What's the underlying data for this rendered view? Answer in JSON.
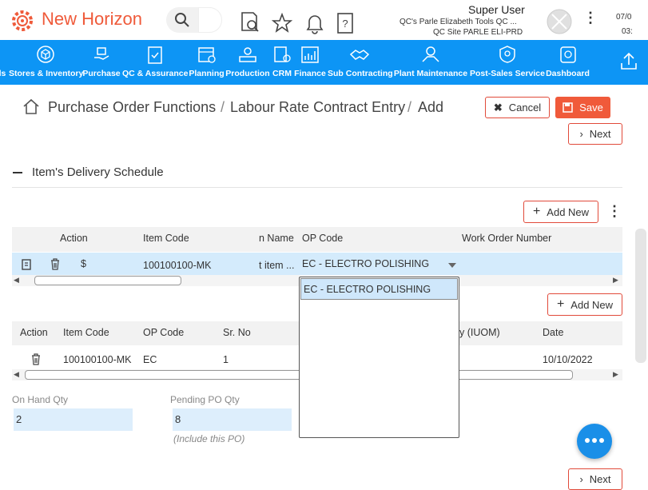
{
  "header": {
    "app_name": "New Horizon",
    "user_name": "Super User",
    "user_org": "QC's Parle Elizabeth Tools QC ...",
    "user_site": "QC Site PARLE ELI-PRD",
    "date_part1": "07/0",
    "date_part2": "03:",
    "kebab": "⋮"
  },
  "nav": {
    "items": [
      {
        "label": "ls"
      },
      {
        "label": "Stores & Inventory"
      },
      {
        "label": "Purchase"
      },
      {
        "label": "QC & Assurance"
      },
      {
        "label": "Planning"
      },
      {
        "label": "Production"
      },
      {
        "label": "CRM"
      },
      {
        "label": "Finance"
      },
      {
        "label": "Sub Contracting"
      },
      {
        "label": "Plant Maintenance"
      },
      {
        "label": "Post-Sales Service"
      },
      {
        "label": "Dashboard"
      }
    ]
  },
  "breadcrumb": {
    "part1": "Purchase Order Functions",
    "sep1": "/",
    "part2": "Labour Rate Contract Entry",
    "sep2": "/",
    "part3": "Add"
  },
  "actions": {
    "cancel": "Cancel",
    "save": "Save",
    "next": "Next",
    "add_new": "Add New"
  },
  "section": {
    "title": "Item's Delivery Schedule"
  },
  "grid1": {
    "headers": {
      "action": "Action",
      "item_code": "Item Code",
      "item_name": "n Name",
      "op_code": "OP Code",
      "wo_number": "Work Order Number"
    },
    "row": {
      "item_code": "100100100-MK",
      "item_name": "t item ...",
      "op_code": "EC - ELECTRO POLISHING",
      "dollar": "$"
    }
  },
  "dropdown": {
    "options": [
      "EC - ELECTRO POLISHING"
    ]
  },
  "grid2": {
    "headers": {
      "action": "Action",
      "item_code": "Item Code",
      "op_code": "OP Code",
      "sr_no": "Sr. No",
      "qty": "y (IUOM)",
      "date": "Date"
    },
    "row": {
      "item_code": "100100100-MK",
      "op_code": "EC",
      "sr_no": "1",
      "date": "10/10/2022"
    }
  },
  "fields": {
    "on_hand_label": "On Hand Qty",
    "on_hand_value": "2",
    "pending_label": "Pending PO Qty",
    "pending_value": "8",
    "pending_hint": "(Include this PO)"
  },
  "colors": {
    "brand": "#ef5a3a",
    "nav_bg": "#0d95f5",
    "row_selected": "#d4ebfc",
    "field_bg": "#ddeefc"
  }
}
